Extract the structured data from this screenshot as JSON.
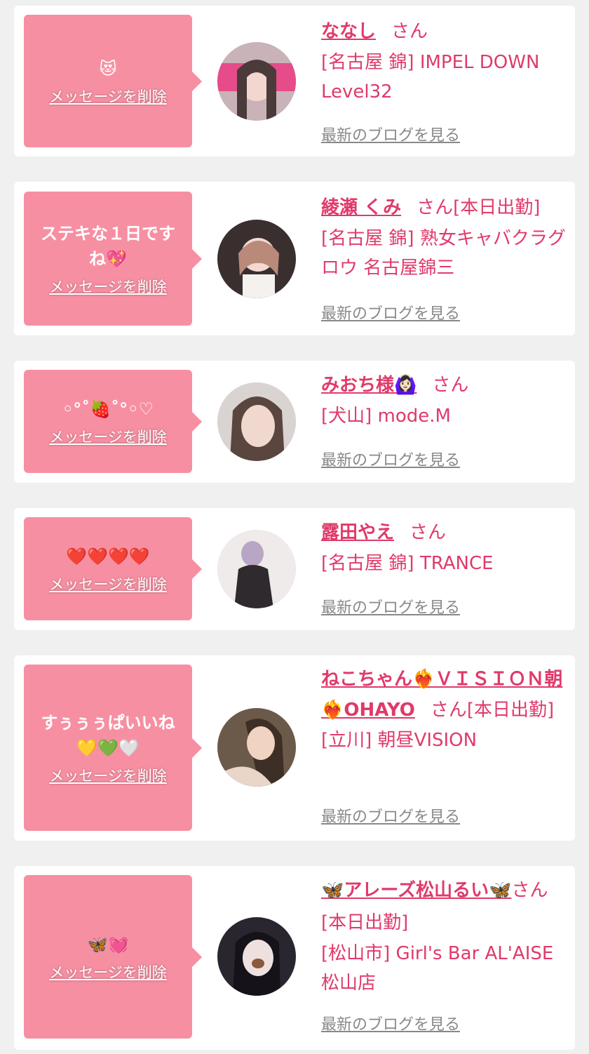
{
  "delete_label": "メッセージを削除",
  "blog_label": "最新のブログを見る",
  "colors": {
    "bubble": "#f78fa2",
    "name": "#e03a6a",
    "blog_link": "#888888"
  },
  "messages": [
    {
      "message": "😻",
      "name": "ななし",
      "suffix": "さん",
      "shop": "[名古屋 錦] IMPEL DOWN Level32",
      "avatar_icon": "avatar-photo"
    },
    {
      "message": "ステキな１日です\nね💖",
      "name": "綾瀬 くみ",
      "suffix": "さん[本日出勤]",
      "shop": "[名古屋 錦] 熟女キャバクラグロウ 名古屋錦三",
      "avatar_icon": "avatar-photo"
    },
    {
      "message": "◦°˚🍓˚°◦♡",
      "name": "みおち様🙆🏻‍♀️",
      "suffix": "さん",
      "shop": "[犬山] mode.M",
      "avatar_icon": "avatar-photo"
    },
    {
      "message": "❤️❤️❤️❤️",
      "name": "露田やえ",
      "suffix": "さん",
      "shop": "[名古屋 錦] TRANCE",
      "avatar_icon": "avatar-photo"
    },
    {
      "message": "すぅぅぅぱいいね\n💛💚🤍",
      "name": "ねこちゃん❤️‍🔥ＶＩＳＩＯＮ朝❤️‍🔥OHAYO",
      "suffix": "さん[本日出勤]",
      "shop": "[立川] 朝昼VISION",
      "avatar_icon": "avatar-photo"
    },
    {
      "message": "🦋💓",
      "name": "🦋アレーズ松山るい🦋",
      "suffix": "さん[本日出勤]",
      "shop": "[松山市] Girl's Bar AL'AISE 松山店",
      "avatar_icon": "avatar-photo"
    }
  ]
}
